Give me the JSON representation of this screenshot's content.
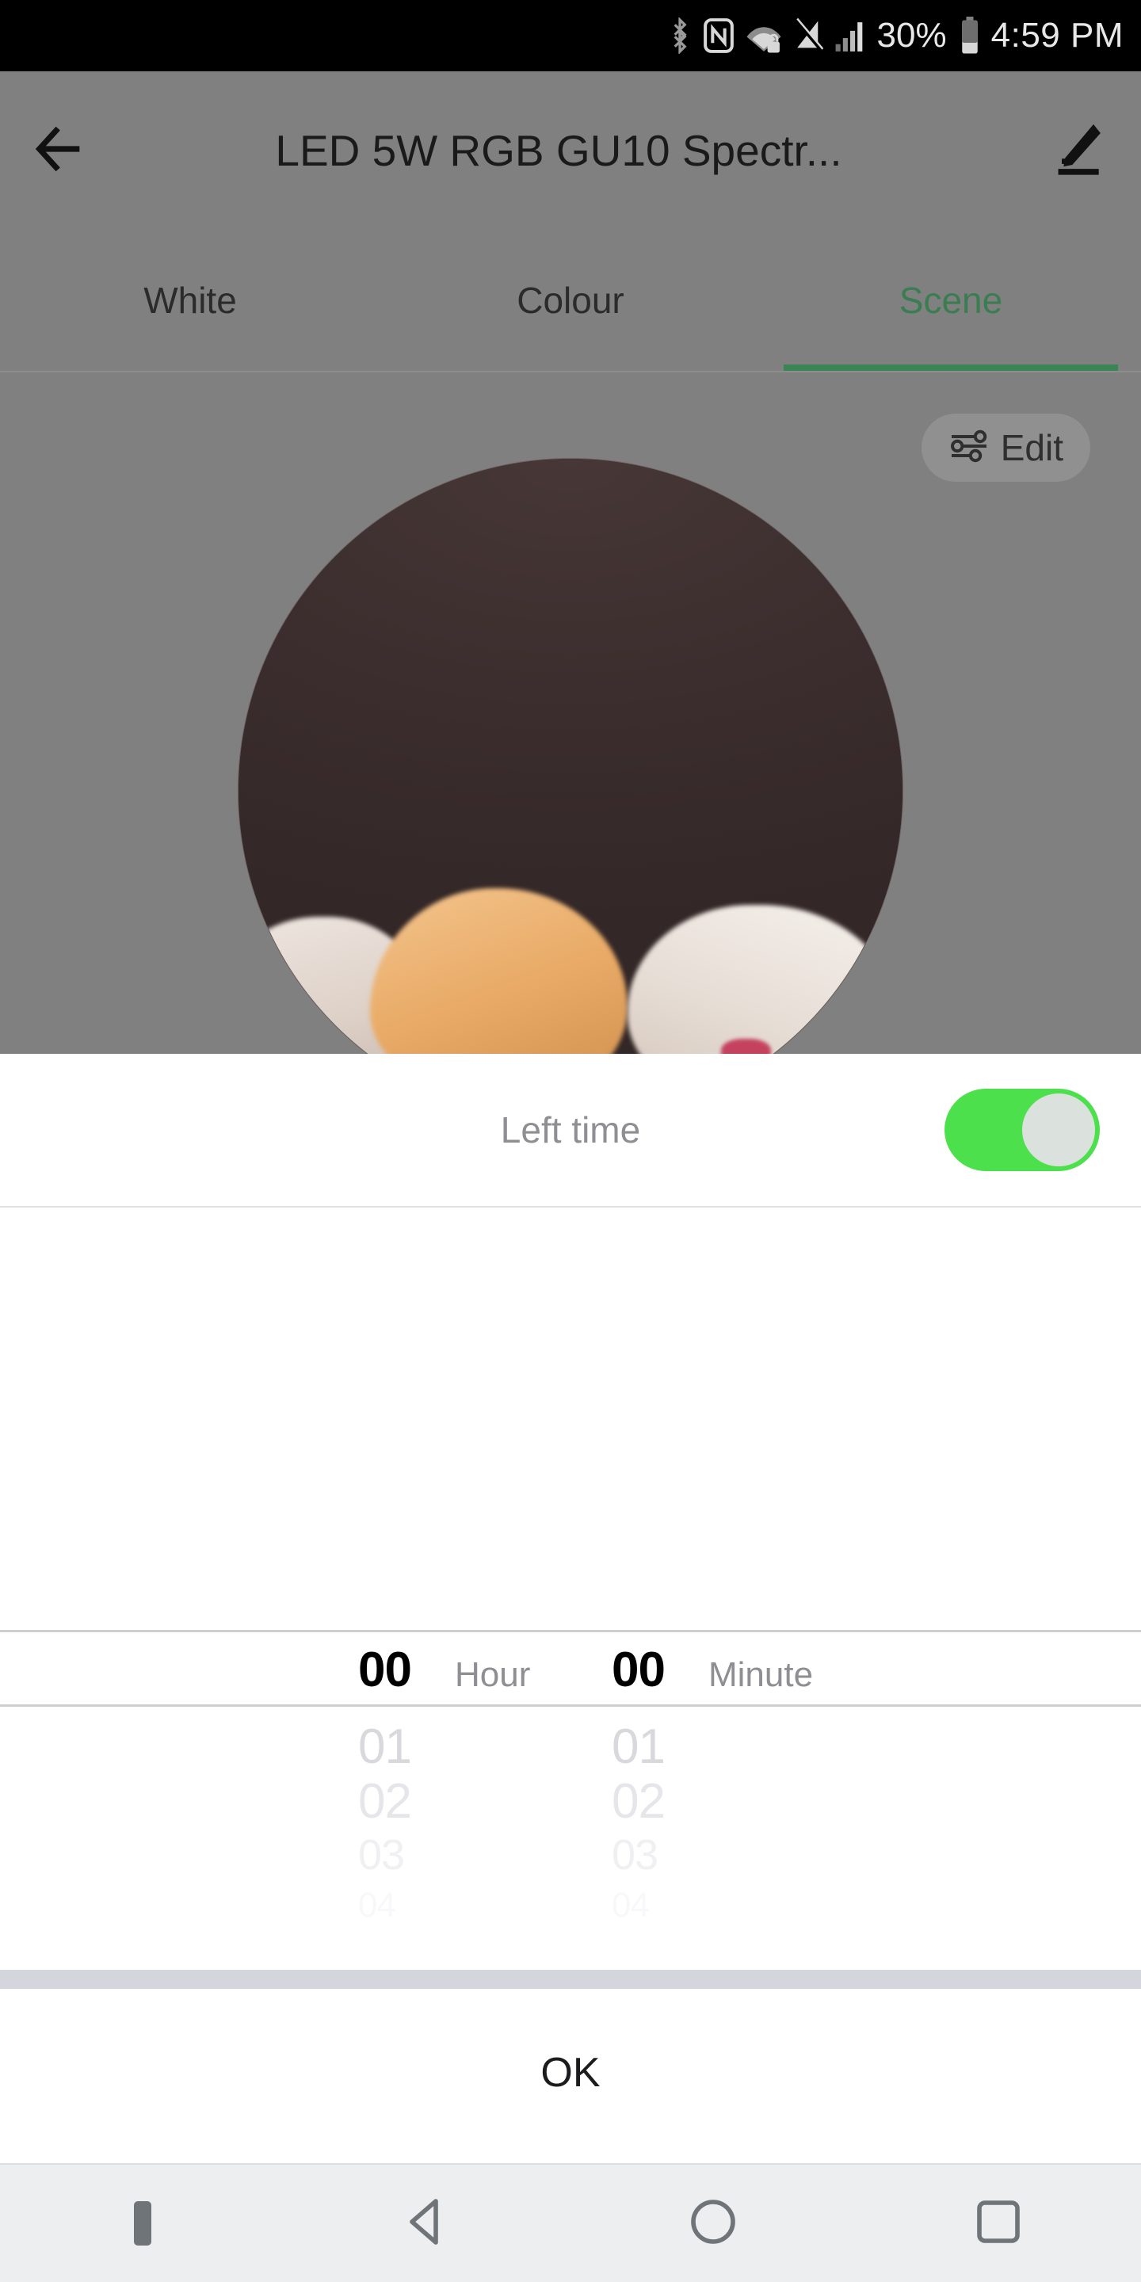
{
  "status_bar": {
    "icons": [
      "bluetooth-icon",
      "nfc-icon",
      "wifi-lock-icon",
      "signal-off-icon",
      "cellular-signal-icon"
    ],
    "battery_percent": "30%",
    "time": "4:59 PM"
  },
  "app_bar": {
    "back_icon": "arrow-left-icon",
    "title": "LED 5W RGB GU10 Spectr...",
    "edit_icon": "pencil-icon"
  },
  "tabs": [
    {
      "label": "White",
      "active": false
    },
    {
      "label": "Colour",
      "active": false
    },
    {
      "label": "Scene",
      "active": true
    }
  ],
  "scene": {
    "edit_button": {
      "label": "Edit",
      "icon": "sliders-icon"
    },
    "photo_alt": "sleeping-cats-photo"
  },
  "dialog": {
    "left_time": {
      "label": "Left time",
      "toggle_state": "on",
      "toggle_color": "#4ce04c"
    },
    "picker": {
      "hour": {
        "selected": "00",
        "unit": "Hour",
        "upcoming": [
          "01",
          "02",
          "03",
          "04"
        ]
      },
      "minute": {
        "selected": "00",
        "unit": "Minute",
        "upcoming": [
          "01",
          "02",
          "03",
          "04"
        ]
      }
    },
    "confirm_label": "OK"
  },
  "nav_bar": {
    "hide_icon": "hide-navbar-icon",
    "back_icon": "nav-back-triangle-icon",
    "home_icon": "nav-home-circle-icon",
    "recents_icon": "nav-recents-square-icon"
  },
  "colors": {
    "accent_green": "#3c8355",
    "toggle_green": "#4ce04c",
    "dim_overlay": "#808080",
    "separator": "#d4d6dd"
  }
}
